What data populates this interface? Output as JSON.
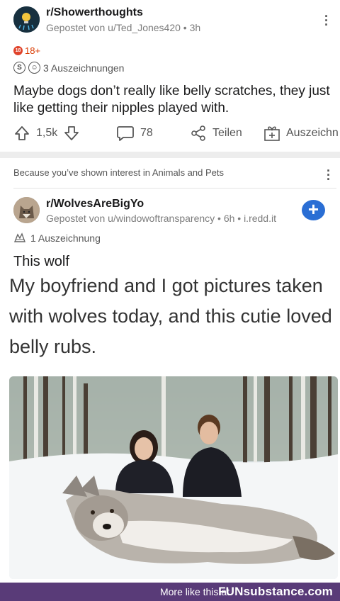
{
  "post1": {
    "subreddit": "r/Showerthoughts",
    "meta": "Gepostet von u/Ted_Jones420 • 3h",
    "nsfw_badge": "18",
    "nsfw_label": "18+",
    "awards_label": "3 Auszeichnungen",
    "title": "Maybe dogs don’t really like belly scratches, they just like getting their nipples played with.",
    "votes": "1,5k",
    "comments": "78",
    "share": "Teilen",
    "award": "Auszeichn"
  },
  "recommendation": {
    "text": "Because you’ve shown interest in Animals and Pets"
  },
  "post2": {
    "subreddit": "r/WolvesAreBigYo",
    "meta": "Gepostet von u/windowoftransparency • 6h • i.redd.it",
    "awards_label": "1 Auszeichnung",
    "title": "This wolf",
    "caption": "My boyfriend and I got pictures taken with wolves today, and this cutie loved belly rubs."
  },
  "footer": {
    "more": "More like this at",
    "brand": "FUNsubstance.com"
  },
  "colors": {
    "join_button": "#2a6ed4",
    "footer_bg": "#593b78",
    "nsfw": "#d93a00"
  },
  "icons": [
    "upvote-icon",
    "downvote-icon",
    "comment-icon",
    "share-icon",
    "award-add-icon",
    "join-plus-icon"
  ]
}
